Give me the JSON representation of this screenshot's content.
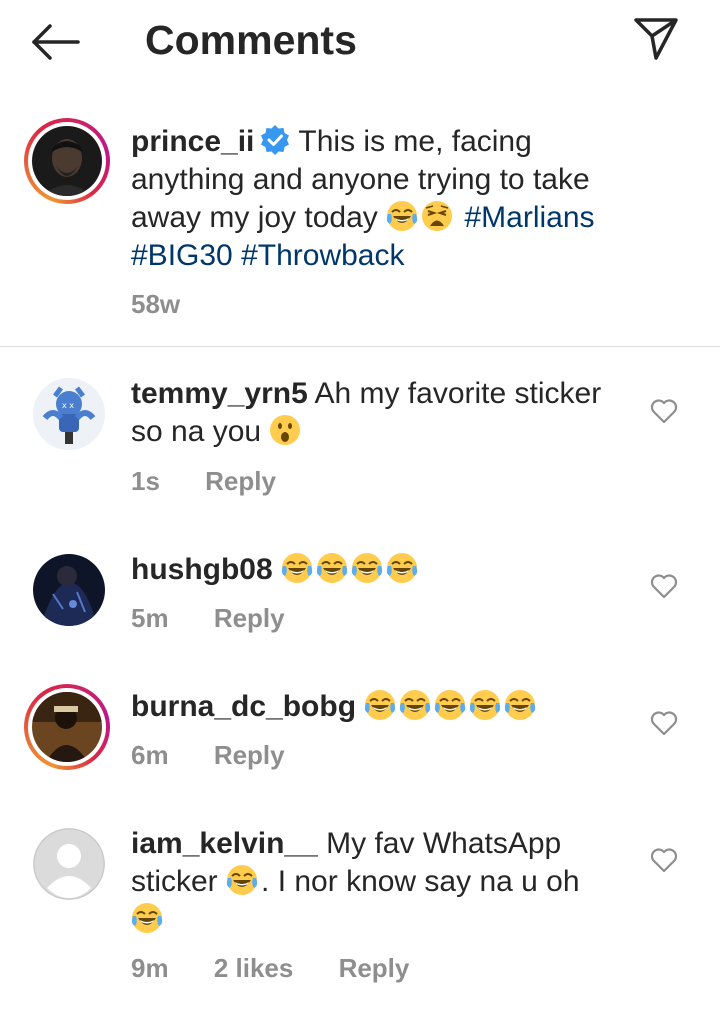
{
  "header": {
    "title": "Comments",
    "back_icon": "back-arrow-icon",
    "share_icon": "direct-send-icon"
  },
  "caption": {
    "username": "prince_ii",
    "verified": true,
    "text_line1": "This is me, facing",
    "text_line2": "anything and anyone trying to take",
    "text_line3": "away my joy today",
    "hashtags": [
      "#Marlians",
      "#BIG30",
      "#Throwback"
    ],
    "time": "58w"
  },
  "comments": [
    {
      "username": "temmy_yrn5",
      "text_a": "Ah my favorite sticker",
      "text_b": "so na you",
      "time": "1s",
      "reply": "Reply"
    },
    {
      "username": "hushgb08",
      "time": "5m",
      "reply": "Reply"
    },
    {
      "username": "burna_dc_bobg",
      "time": "6m",
      "reply": "Reply"
    },
    {
      "username": "iam_kelvin__",
      "text_a": "My fav WhatsApp",
      "text_b": "sticker",
      "text_c": ". I nor know say na u oh",
      "time": "9m",
      "likes": "2 likes",
      "reply": "Reply"
    }
  ],
  "colors": {
    "text": "#262626",
    "muted": "#8e8e8e",
    "hashtag": "#00376b",
    "verified": "#3897f0",
    "divider": "#dbdbdb"
  }
}
